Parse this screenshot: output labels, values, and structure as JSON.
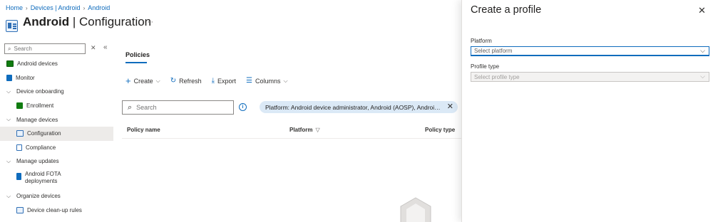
{
  "breadcrumb": [
    "Home",
    "Devices | Android",
    "Android"
  ],
  "page": {
    "title_bold": "Android",
    "title_rest": " | Configuration",
    "more": "···"
  },
  "sidebar": {
    "search_placeholder": "Search",
    "items": [
      {
        "label": "Android devices",
        "level": 0,
        "icon": "android-devices-icon",
        "color": "#107c10"
      },
      {
        "label": "Monitor",
        "level": 0,
        "icon": "monitor-icon",
        "color": "#0f6cbd"
      },
      {
        "label": "Device onboarding",
        "level": 0,
        "chevron": true
      },
      {
        "label": "Enrollment",
        "level": 1,
        "icon": "enrollment-icon",
        "color": "#107c10"
      },
      {
        "label": "Manage devices",
        "level": 0,
        "chevron": true
      },
      {
        "label": "Configuration",
        "level": 1,
        "icon": "configuration-icon",
        "color": "#2f6fb6",
        "selected": true
      },
      {
        "label": "Compliance",
        "level": 1,
        "icon": "compliance-icon",
        "color": "#2f6fb6"
      },
      {
        "label": "Manage updates",
        "level": 0,
        "chevron": true
      },
      {
        "label": "Android FOTA deployments",
        "level": 1,
        "icon": "fota-icon",
        "color": "#0f6cbd"
      },
      {
        "label": "Organize devices",
        "level": 0,
        "chevron": true
      },
      {
        "label": "Device clean-up rules",
        "level": 1,
        "icon": "cleanup-rules-icon",
        "color": "#2f6fb6"
      }
    ]
  },
  "main": {
    "tab": "Policies",
    "toolbar": {
      "create": "Create",
      "refresh": "Refresh",
      "export": "Export",
      "columns": "Columns"
    },
    "search_placeholder": "Search",
    "filter_pill": "Platform: Android device administrator, Android (AOSP), Android Enterprise",
    "columns": [
      "Policy name",
      "Platform",
      "Policy type"
    ]
  },
  "panel": {
    "title": "Create a profile",
    "platform_label": "Platform",
    "platform_placeholder": "Select platform",
    "profile_type_label": "Profile type",
    "profile_type_placeholder": "Select profile type"
  }
}
